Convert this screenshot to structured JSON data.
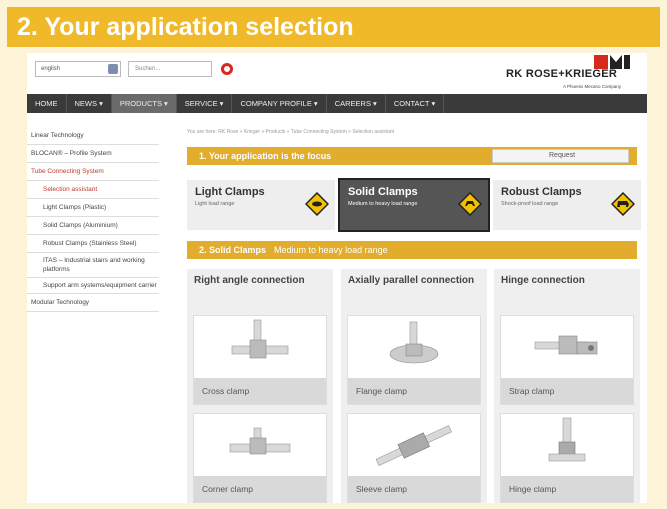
{
  "banner": {
    "title": "2. Your application selection"
  },
  "header": {
    "language": "english",
    "search_placeholder": "Suchen...",
    "logo_text": "RK ROSE+KRIEGER",
    "logo_subtext": "A Phoenix Mecano Company"
  },
  "nav": [
    "HOME",
    "NEWS ▾",
    "PRODUCTS ▾",
    "SERVICE ▾",
    "COMPANY PROFILE ▾",
    "CAREERS ▾",
    "CONTACT ▾"
  ],
  "sidebar": {
    "items": [
      "Linear Technology",
      "BLOCAN® – Profile System",
      "Tube Connecting System",
      "Selection assistant",
      "Light Clamps (Plastic)",
      "Solid Clamps (Aluminium)",
      "Robust Clamps (Stainless Steel)",
      "ITAS – Industrial stairs and working platforms",
      "Support arm systems/equipment carrier",
      "Modular Technology"
    ]
  },
  "breadcrumb": "You are here: RK Rose + Krieger » Products » Tube Connecting System » Selection assistant",
  "step1": {
    "title": "1. Your application is the focus",
    "request": "Request"
  },
  "clamps": [
    {
      "title": "Light Clamps",
      "subtitle": "Light load range"
    },
    {
      "title": "Solid Clamps",
      "subtitle": "Medium to heavy load range"
    },
    {
      "title": "Robust Clamps",
      "subtitle": "Shock-proof load range"
    }
  ],
  "step2": {
    "title": "2. Solid Clamps",
    "subtitle": "Medium to heavy load range"
  },
  "columns": [
    {
      "heading": "Right angle connection",
      "cards": [
        "Cross clamp",
        "Corner clamp"
      ]
    },
    {
      "heading": "Axially parallel connection",
      "cards": [
        "Flange clamp",
        "Sleeve clamp"
      ]
    },
    {
      "heading": "Hinge connection",
      "cards": [
        "Strap clamp",
        "Hinge clamp"
      ]
    }
  ],
  "colors": {
    "banner": "#f0b92a",
    "bar": "#e2ac2c",
    "nav": "#3a3a3a",
    "accent_red": "#c0392b"
  }
}
